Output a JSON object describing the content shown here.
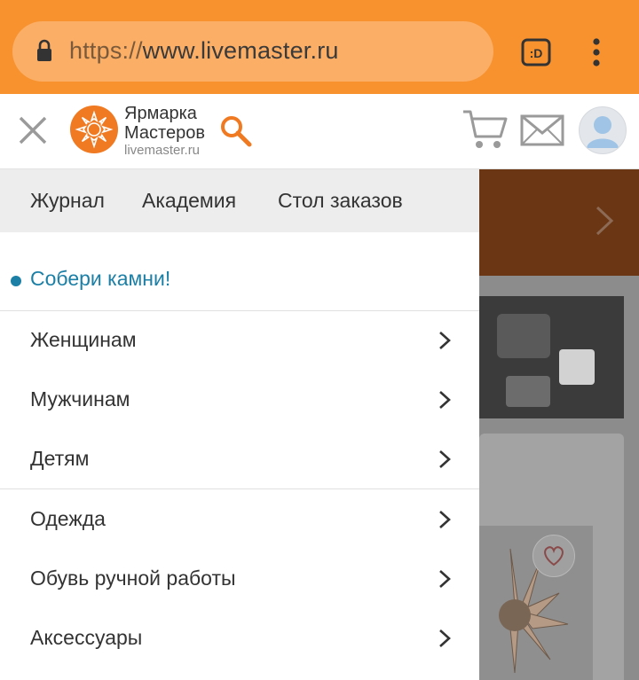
{
  "browser": {
    "url_scheme": "https://",
    "url_host": "www.livemaster.ru",
    "tabs_button_label": ":D",
    "accent_color": "#f7922f"
  },
  "site_header": {
    "logo_line1": "Ярмарка",
    "logo_line2": "Мастеров",
    "logo_line3": "livemaster.ru",
    "icons": [
      "close-icon",
      "search-icon",
      "cart-icon",
      "mail-icon",
      "user-avatar-icon"
    ]
  },
  "drawer": {
    "top_nav": [
      "Журнал",
      "Академия",
      "Стол заказов"
    ],
    "promo": "Собери камни!",
    "promo_color": "#1b7fa6",
    "group1": [
      "Женщинам",
      "Мужчинам",
      "Детям"
    ],
    "group2": [
      "Одежда",
      "Обувь ручной работы",
      "Аксессуары"
    ]
  }
}
